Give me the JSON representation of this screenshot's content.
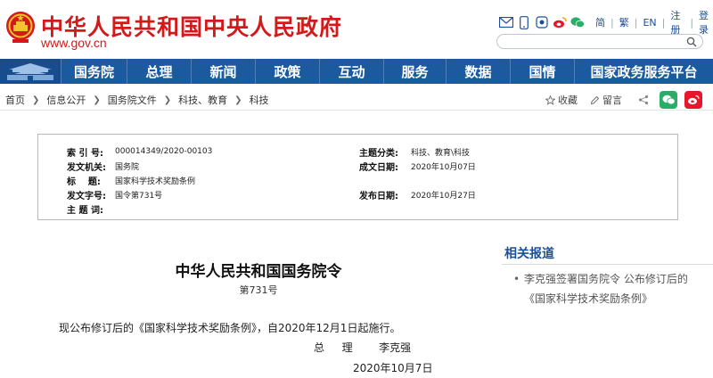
{
  "header": {
    "site_title": "中华人民共和国中央人民政府",
    "site_domain": "www.gov.cn",
    "links": [
      "简",
      "繁",
      "EN",
      "注册",
      "登录"
    ],
    "search_placeholder": ""
  },
  "nav": {
    "items": [
      "国务院",
      "总理",
      "新闻",
      "政策",
      "互动",
      "服务",
      "数据",
      "国情",
      "国家政务服务平台"
    ]
  },
  "breadcrumb": {
    "items": [
      "首页",
      "信息公开",
      "国务院文件",
      "科技、教育",
      "科技"
    ],
    "collect": "收藏",
    "message": "留言"
  },
  "info": {
    "index_label": "索 引 号:",
    "index_value": "000014349/2020-00103",
    "topic_label": "主题分类:",
    "topic_value": "科技、教育\\科技",
    "issuer_label": "发文机关:",
    "issuer_value": "国务院",
    "created_label": "成文日期:",
    "created_value": "2020年10月07日",
    "title_label": "标    题:",
    "title_value": "国家科学技术奖励条例",
    "docno_label": "发文字号:",
    "docno_value": "国令第731号",
    "published_label": "发布日期:",
    "published_value": "2020年10月27日",
    "keywords_label": "主 题 词:",
    "keywords_value": ""
  },
  "article": {
    "title": "中华人民共和国国务院令",
    "number": "第731号",
    "body": "现公布修订后的《国家科学技术奖励条例》，自2020年12月1日起施行。",
    "signature": "总  理   李克强",
    "date": "2020年10月7日"
  },
  "related": {
    "title": "相关报道",
    "item": "李克强签署国务院令 公布修订后的《国家科学技术奖励条例》"
  },
  "colors": {
    "brand_red": "#d21a1a",
    "nav_blue": "#1c5aa0",
    "link_blue": "#1b4f99",
    "wechat_green": "#2aae67",
    "weibo_red": "#e6162d"
  }
}
